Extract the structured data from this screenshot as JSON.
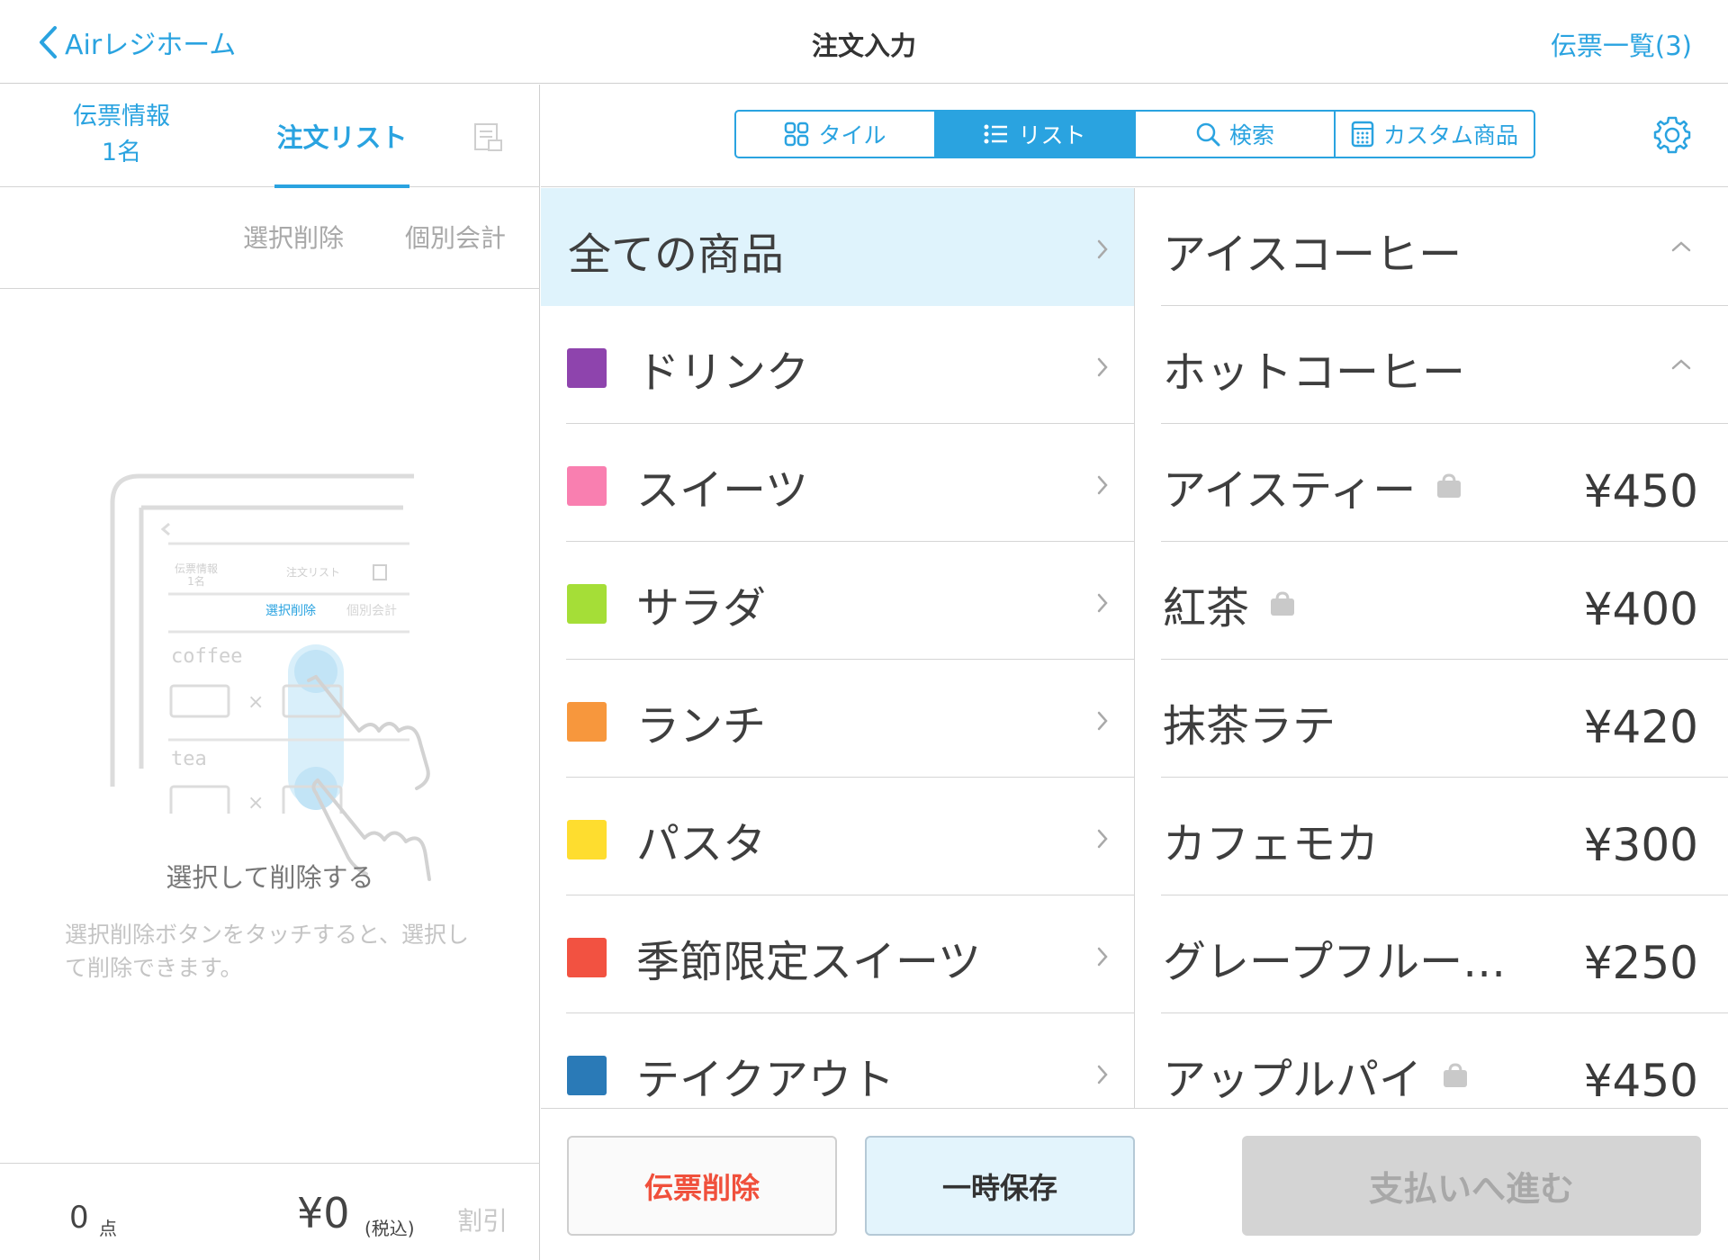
{
  "header": {
    "back_label": "Airレジホーム",
    "title": "注文入力",
    "slip_list_label": "伝票一覧(3)"
  },
  "left_panel": {
    "tab_info_line1": "伝票情報",
    "tab_info_line2": "1名",
    "tab_orders": "注文リスト",
    "action_select_delete": "選択削除",
    "action_split_payment": "個別会計",
    "illustration": {
      "tab_info_line1": "伝票情報",
      "tab_info_line2": "1名",
      "tab_orders": "注文リスト",
      "action_select_delete": "選択削除",
      "action_split_payment": "個別会計",
      "item1": "coffee",
      "item2": "tea",
      "times": "×"
    },
    "empty_title": "選択して削除する",
    "empty_description": "選択削除ボタンをタッチすると、選択して削除できます。",
    "footer": {
      "count": "0",
      "count_unit": "点",
      "total": "¥0",
      "tax_label": "(税込)",
      "discount_label": "割引"
    }
  },
  "view_toggle": {
    "items": [
      {
        "label": "タイル",
        "icon": "grid-icon",
        "active": false
      },
      {
        "label": "リスト",
        "icon": "list-icon",
        "active": true
      },
      {
        "label": "検索",
        "icon": "search-icon",
        "active": false
      },
      {
        "label": "カスタム商品",
        "icon": "calculator-icon",
        "active": false
      }
    ]
  },
  "categories": [
    {
      "label": "全ての商品",
      "color": null,
      "selected": true
    },
    {
      "label": "ドリンク",
      "color": "#8e44ad",
      "selected": false
    },
    {
      "label": "スイーツ",
      "color": "#f97fb0",
      "selected": false
    },
    {
      "label": "サラダ",
      "color": "#a5de37",
      "selected": false
    },
    {
      "label": "ランチ",
      "color": "#f7973d",
      "selected": false
    },
    {
      "label": "パスタ",
      "color": "#fedd2f",
      "selected": false
    },
    {
      "label": "季節限定スイーツ",
      "color": "#f25241",
      "selected": false
    },
    {
      "label": "テイクアウト",
      "color": "#2a7ab7",
      "selected": false
    }
  ],
  "products": [
    {
      "name": "アイスコーヒー",
      "price": "",
      "has_bag": false,
      "expandable": true
    },
    {
      "name": "ホットコーヒー",
      "price": "",
      "has_bag": false,
      "expandable": true
    },
    {
      "name": "アイスティー",
      "price": "¥450",
      "has_bag": true,
      "expandable": false
    },
    {
      "name": "紅茶",
      "price": "¥400",
      "has_bag": true,
      "expandable": false
    },
    {
      "name": "抹茶ラテ",
      "price": "¥420",
      "has_bag": false,
      "expandable": false
    },
    {
      "name": "カフェモカ",
      "price": "¥300",
      "has_bag": false,
      "expandable": false
    },
    {
      "name": "グレープフルー…",
      "price": "¥250",
      "has_bag": false,
      "expandable": false
    },
    {
      "name": "アップルパイ",
      "price": "¥450",
      "has_bag": true,
      "expandable": false
    }
  ],
  "actions": {
    "delete_slip": "伝票削除",
    "hold": "一時保存",
    "proceed_payment": "支払いへ進む"
  },
  "colors": {
    "accent": "#2aa3e0",
    "danger": "#f0503c",
    "selected_bg": "#dff3fc"
  }
}
